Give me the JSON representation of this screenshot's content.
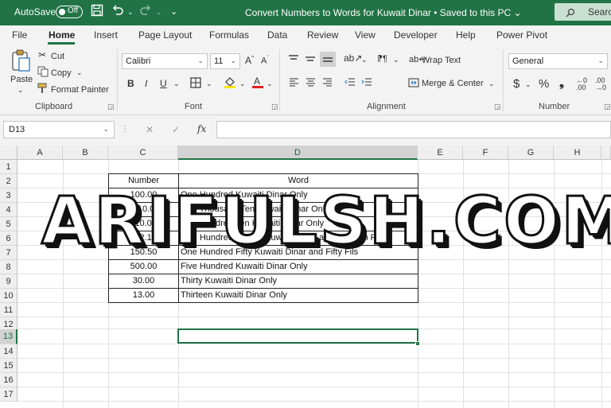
{
  "titlebar": {
    "autosave_label": "AutoSave",
    "autosave_state": "Off",
    "title": "Convert Numbers to Words for Kuwait Dinar • Saved to this PC ",
    "title_chevron": "⌄",
    "search_label": "Search"
  },
  "ribbon_tabs": [
    "File",
    "Home",
    "Insert",
    "Page Layout",
    "Formulas",
    "Data",
    "Review",
    "View",
    "Developer",
    "Help",
    "Power Pivot"
  ],
  "ribbon": {
    "clipboard": {
      "paste": "Paste",
      "cut": "Cut",
      "copy": "Copy",
      "format_painter": "Format Painter",
      "group": "Clipboard"
    },
    "font": {
      "name": "Calibri",
      "size": "11",
      "group": "Font",
      "bold": "B",
      "italic": "I",
      "underline": "U"
    },
    "alignment": {
      "wrap": "Wrap Text",
      "merge": "Merge & Center",
      "group": "Alignment"
    },
    "number": {
      "format": "General",
      "group": "Number",
      "currency": "$",
      "percent": "%",
      "comma": "❟"
    }
  },
  "formula_bar": {
    "name_box": "D13",
    "fx": "fx",
    "cancel": "✕",
    "enter": "✓",
    "formula": ""
  },
  "columns": [
    "A",
    "B",
    "C",
    "D",
    "E",
    "F",
    "G",
    "H"
  ],
  "rows": [
    "1",
    "2",
    "3",
    "4",
    "5",
    "6",
    "7",
    "8",
    "9",
    "10",
    "11",
    "12",
    "13",
    "14",
    "15",
    "16",
    "17"
  ],
  "table": {
    "headers": {
      "number": "Number",
      "word": "Word"
    },
    "rows": [
      {
        "number": "100.00",
        "word": "One Hundred  Kuwaiti Dinar Only"
      },
      {
        "number": "1010.00",
        "word": "One Thousand Ten Kuwaiti Dinar Only"
      },
      {
        "number": "110.00",
        "word": "One Hundred Ten Kuwaiti Dinar Only"
      },
      {
        "number": "112.13",
        "word": "One Hundred Twelve Kuwaiti Dinar and Thirteen Fils"
      },
      {
        "number": "150.50",
        "word": "One Hundred Fifty Kuwaiti Dinar and Fifty Fils"
      },
      {
        "number": "500.00",
        "word": "Five Hundred  Kuwaiti Dinar Only"
      },
      {
        "number": "30.00",
        "word": "Thirty Kuwaiti Dinar Only"
      },
      {
        "number": "13.00",
        "word": "Thirteen Kuwaiti Dinar Only"
      }
    ]
  },
  "watermark": "ARIFULSH.COM",
  "colors": {
    "accent": "#217346",
    "selected_header": "#d2d2d2"
  }
}
